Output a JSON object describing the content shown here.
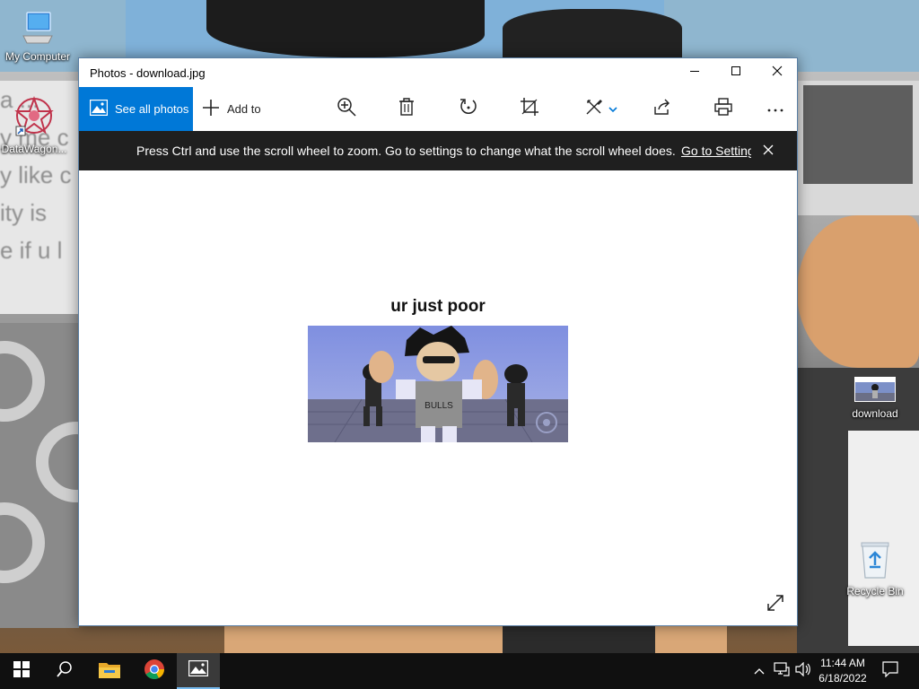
{
  "desktop": {
    "icons": [
      {
        "label": "My Computer",
        "icon": "computer-icon"
      },
      {
        "label": "DataWagon...",
        "icon": "datawagon-icon"
      },
      {
        "label": "download",
        "icon": "image-file-icon"
      },
      {
        "label": "Recycle Bin",
        "icon": "recycle-bin-icon"
      }
    ],
    "wallpaper_text": [
      "a ...",
      "y me c",
      "y like c",
      "ity is",
      "e if u l"
    ]
  },
  "window": {
    "title": "Photos - download.jpg",
    "controls": {
      "minimize": "minimize-icon",
      "maximize": "maximize-icon",
      "close": "close-icon"
    }
  },
  "toolbar": {
    "see_all_label": "See all photos",
    "add_to_label": "Add to",
    "tools": [
      "zoom-in-icon",
      "delete-icon",
      "rotate-icon",
      "crop-icon",
      "edit-icon",
      "share-icon",
      "print-icon",
      "more-icon"
    ]
  },
  "infobar": {
    "message": "Press Ctrl and use the scroll wheel to zoom. Go to settings to change what the scroll wheel does.",
    "link": "Go to Settings"
  },
  "photo": {
    "caption": "ur just poor"
  },
  "taskbar": {
    "items": [
      "start-icon",
      "search-icon",
      "file-explorer-icon",
      "chrome-icon",
      "photos-icon"
    ],
    "clock_time": "11:44 AM",
    "clock_date": "6/18/2022"
  },
  "colors": {
    "accent": "#0078d7",
    "infobar_bg": "#1f1f1f",
    "taskbar_bg": "#101010"
  }
}
